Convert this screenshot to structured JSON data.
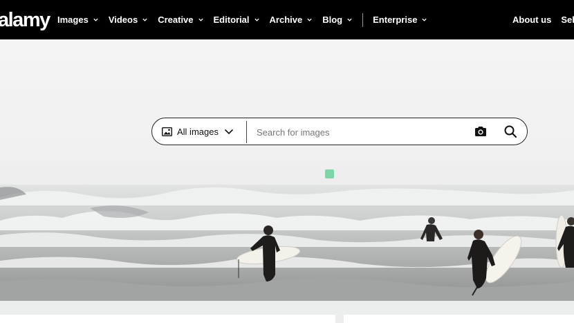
{
  "brand": {
    "logo_text": "alamy"
  },
  "nav": {
    "items": [
      {
        "label": "Images"
      },
      {
        "label": "Videos"
      },
      {
        "label": "Creative"
      },
      {
        "label": "Editorial"
      },
      {
        "label": "Archive"
      },
      {
        "label": "Blog"
      },
      {
        "label": "Enterprise"
      }
    ],
    "right": {
      "about": "About us",
      "sell": "Sell"
    }
  },
  "search": {
    "scope_label": "All images",
    "placeholder": "Search for images",
    "value": ""
  },
  "icons": {
    "scope": "image-icon",
    "dropdown": "chevron-down-icon",
    "camera": "camera-icon",
    "search": "search-icon"
  },
  "colors": {
    "topbar": "#000000",
    "hero_fog": "#f2f2f2",
    "search_border": "#222222",
    "green_marker": "#7fd4a8"
  }
}
